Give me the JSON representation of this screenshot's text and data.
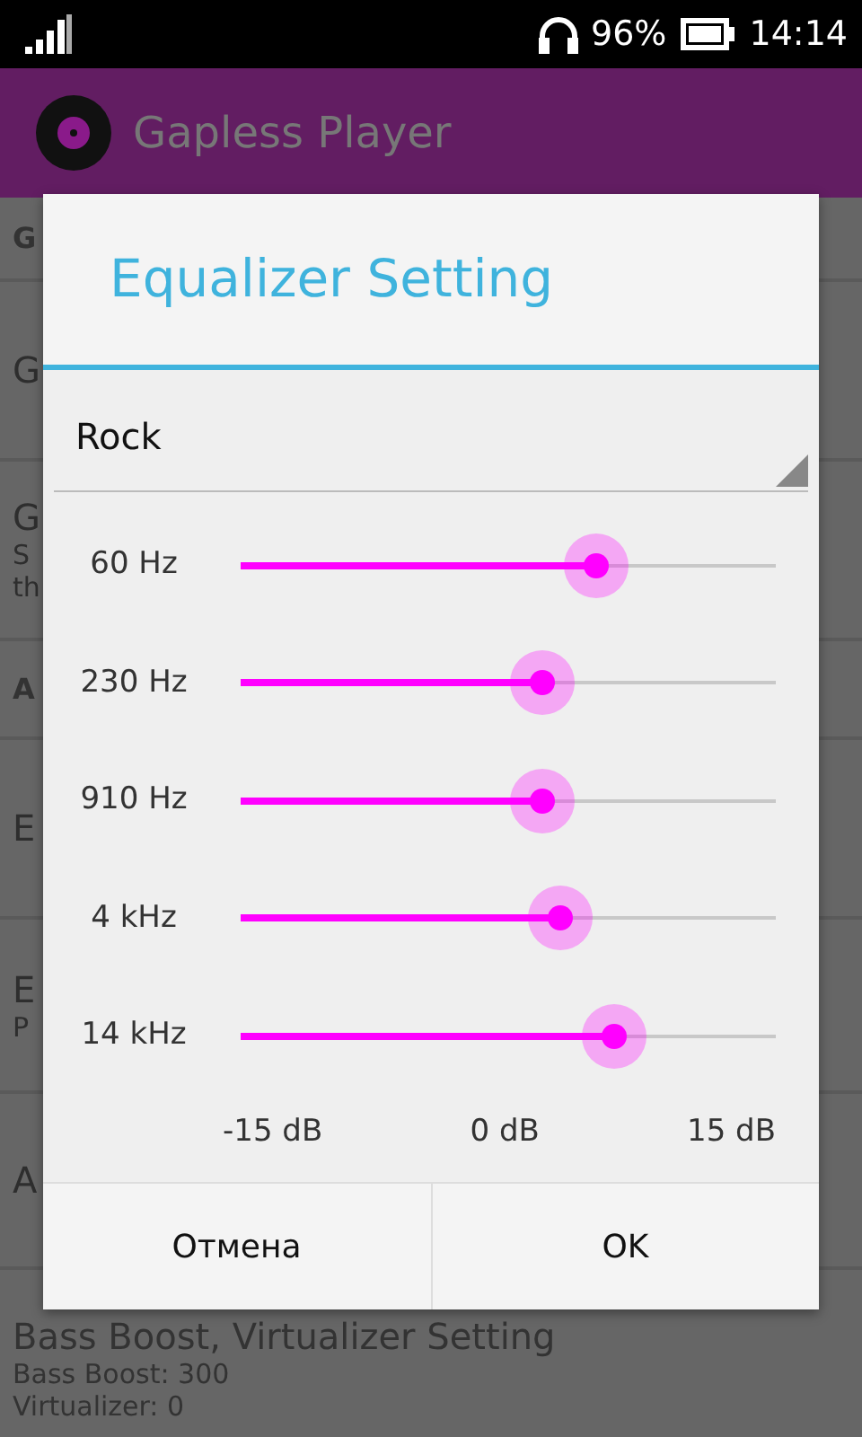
{
  "status_bar": {
    "battery": "96%",
    "time": "14:14"
  },
  "app_bar": {
    "title": "Gapless Player"
  },
  "background_list": [
    {
      "kind": "header",
      "title": "G"
    },
    {
      "kind": "item",
      "title": "G"
    },
    {
      "kind": "item",
      "title": "G",
      "subtitle": [
        "S",
        "th"
      ]
    },
    {
      "kind": "header",
      "title": "A"
    },
    {
      "kind": "item",
      "title": "E"
    },
    {
      "kind": "item",
      "title": "E",
      "subtitle": [
        "P"
      ]
    },
    {
      "kind": "item",
      "title": "A"
    },
    {
      "kind": "item",
      "title": "Bass Boost, Virtualizer Setting",
      "subtitle": [
        "Bass Boost: 300",
        "Virtualizer: 0"
      ]
    }
  ],
  "dialog": {
    "title": "Equalizer Setting",
    "preset": "Rock",
    "bands": [
      {
        "label": "60 Hz",
        "level": 0.664
      },
      {
        "label": "230 Hz",
        "level": 0.564
      },
      {
        "label": "910 Hz",
        "level": 0.564
      },
      {
        "label": "4 kHz",
        "level": 0.597
      },
      {
        "label": "14 kHz",
        "level": 0.698
      }
    ],
    "scale": [
      "-15 dB",
      "0 dB",
      "15 dB"
    ],
    "buttons": [
      "Отмена",
      "OK"
    ]
  }
}
